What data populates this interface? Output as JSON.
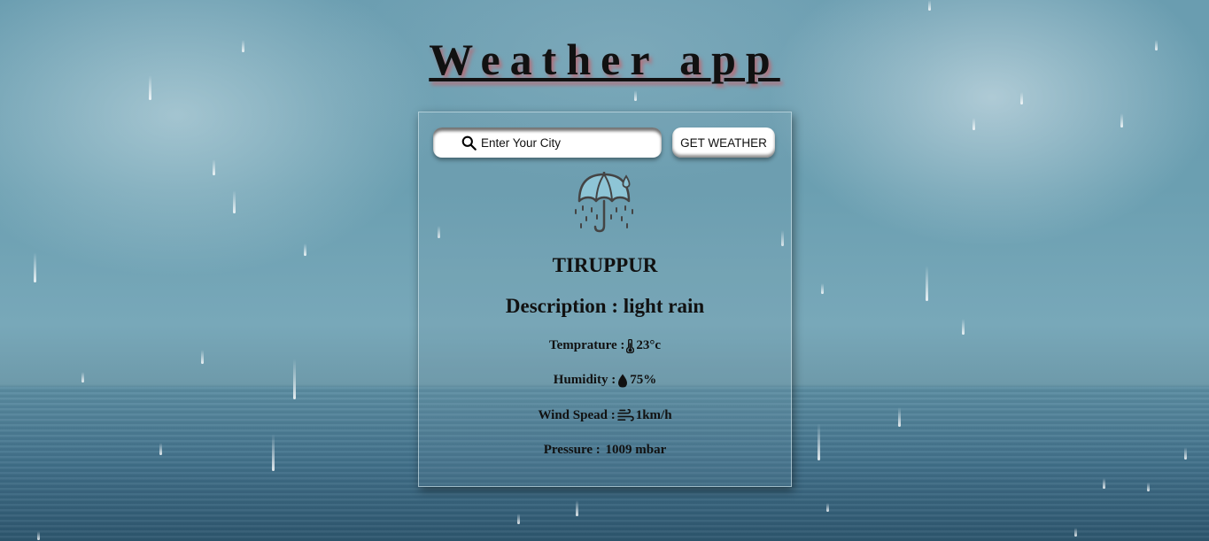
{
  "app": {
    "title": "Weather app"
  },
  "search": {
    "placeholder": "Enter Your City",
    "button_label": "GET WEATHER"
  },
  "weather": {
    "icon": "umbrella-rain-icon",
    "city": "TIRUPPUR",
    "description_label": "Description : ",
    "description": "light rain",
    "temperature_label": "Temprature : ",
    "temperature": "23°c",
    "humidity_label": "Humidity :",
    "humidity": " 75%",
    "wind_label": "Wind Spead :",
    "wind": " 1km/h",
    "pressure_label": "Pressure : ",
    "pressure": "1009 mbar"
  },
  "colors": {
    "background": "#6b9fb1",
    "umbrella": "#8ec5d6",
    "text": "#111111"
  }
}
